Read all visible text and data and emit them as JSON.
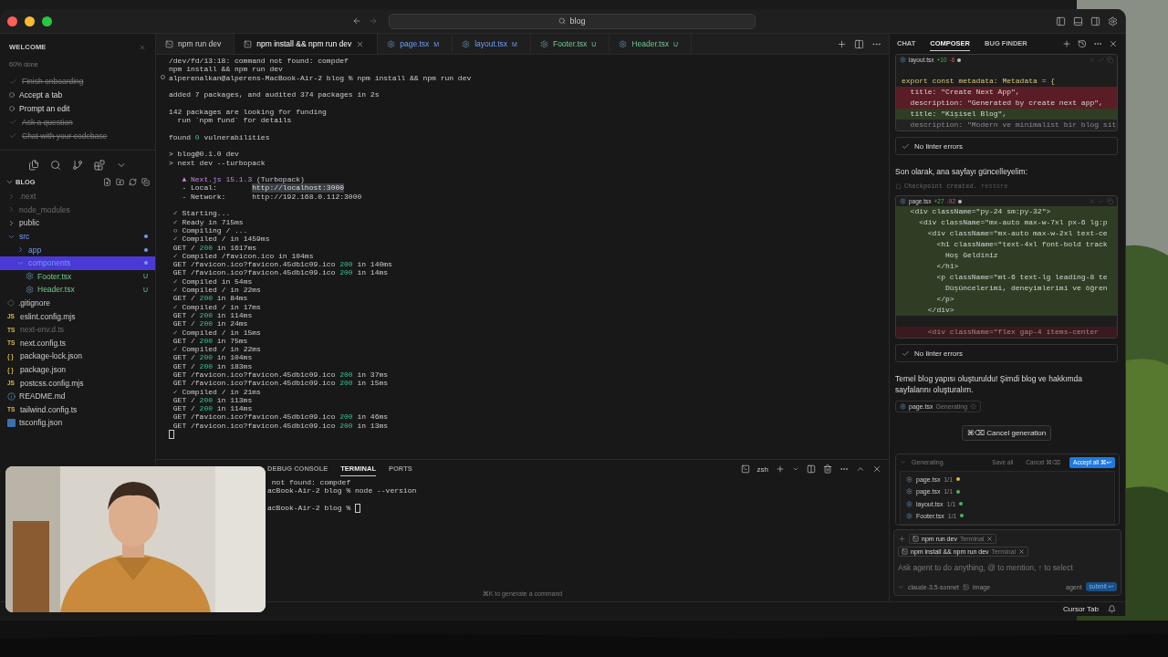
{
  "titlebar": {
    "search": "blog"
  },
  "welcome": {
    "title": "WELCOME",
    "progress": {
      "level": 0.6,
      "label": "60% done"
    },
    "tasks": [
      {
        "label": "Finish onboarding",
        "done": true
      },
      {
        "label": "Accept a tab",
        "done": false
      },
      {
        "label": "Prompt an edit",
        "done": false
      },
      {
        "label": "Ask a question",
        "done": true
      },
      {
        "label": "Chat with your codebase",
        "done": true
      }
    ]
  },
  "explorer": {
    "root": "BLOG",
    "items": [
      {
        "name": ".next",
        "kind": "folder",
        "expanded": false,
        "selected": false,
        "dimmed": true,
        "modified": false
      },
      {
        "name": "node_modules",
        "kind": "folder",
        "expanded": false,
        "selected": false,
        "dimmed": true,
        "modified": false
      },
      {
        "name": "public",
        "kind": "folder",
        "expanded": false,
        "selected": false,
        "dimmed": false,
        "modified": false
      },
      {
        "name": "src",
        "kind": "folder",
        "expanded": true,
        "selected": false,
        "dimmed": false,
        "modified": true,
        "children": [
          {
            "name": "app",
            "kind": "folder",
            "expanded": false,
            "selected": false,
            "dimmed": false,
            "modified": true
          },
          {
            "name": "components",
            "kind": "folder",
            "expanded": true,
            "selected": true,
            "dimmed": false,
            "modified": true,
            "children": [
              {
                "name": "Footer.tsx",
                "kind": "tsx",
                "selected": false,
                "dimmed": false,
                "modified": false,
                "status": "U"
              },
              {
                "name": "Header.tsx",
                "kind": "tsx",
                "selected": false,
                "dimmed": false,
                "modified": false,
                "status": "U"
              }
            ]
          }
        ]
      },
      {
        "name": ".gitignore",
        "kind": "gitignore",
        "selected": false,
        "dimmed": false,
        "modified": false
      },
      {
        "name": "eslint.config.mjs",
        "kind": "script",
        "badge": "JS",
        "selected": false,
        "dimmed": false,
        "modified": false
      },
      {
        "name": "next-env.d.ts",
        "kind": "script",
        "badge": "TS",
        "selected": false,
        "dimmed": true,
        "modified": false
      },
      {
        "name": "next.config.ts",
        "kind": "script",
        "badge": "TS",
        "selected": false,
        "dimmed": false,
        "modified": false
      },
      {
        "name": "package-lock.json",
        "kind": "script",
        "badge": "{ }",
        "selected": false,
        "dimmed": false,
        "modified": false
      },
      {
        "name": "package.json",
        "kind": "script",
        "badge": "{ }",
        "selected": false,
        "dimmed": false,
        "modified": false
      },
      {
        "name": "postcss.config.mjs",
        "kind": "script",
        "badge": "JS",
        "selected": false,
        "dimmed": false,
        "modified": false
      },
      {
        "name": "README.md",
        "kind": "readme",
        "selected": false,
        "dimmed": false,
        "modified": false
      },
      {
        "name": "tailwind.config.ts",
        "kind": "script",
        "badge": "TS",
        "selected": false,
        "dimmed": false,
        "modified": false
      },
      {
        "name": "tsconfig.json",
        "kind": "tsconfig",
        "selected": false,
        "dimmed": false,
        "modified": false
      }
    ]
  },
  "editor_tabs": [
    {
      "label": "npm run dev",
      "kind": "terminal",
      "selected": false,
      "modified": false
    },
    {
      "label": "npm install && npm run dev",
      "kind": "terminal",
      "selected": true,
      "modified": false
    },
    {
      "label": "page.tsx",
      "kind": "tsx",
      "status": "M",
      "modified": true,
      "selected": false
    },
    {
      "label": "layout.tsx",
      "kind": "tsx",
      "status": "M",
      "modified": true,
      "selected": false
    },
    {
      "label": "Footer.tsx",
      "kind": "tsx",
      "status": "U",
      "modified": false,
      "selected": false
    },
    {
      "label": "Header.tsx",
      "kind": "tsx",
      "status": "U",
      "modified": false,
      "selected": false
    }
  ],
  "terminal": {
    "lines": [
      {
        "text": "/dev/fd/13:18: command not found: compdef"
      },
      {
        "text": "npm install && npm run dev"
      },
      {
        "kind": "prompt",
        "text": "alperenalkan@alperens-MacBook-Air-2 blog % npm install && npm run dev"
      },
      {
        "kind": "blank"
      },
      {
        "text": "added 7 packages, and audited 374 packages in 2s"
      },
      {
        "kind": "blank"
      },
      {
        "text": "142 packages are looking for funding"
      },
      {
        "text": "  run `npm fund` for details"
      },
      {
        "kind": "blank"
      },
      {
        "segments": [
          {
            "kind": "plain",
            "text": "found "
          },
          {
            "kind": "ok",
            "text": "0"
          },
          {
            "kind": "plain",
            "text": " vulnerabilities"
          }
        ]
      },
      {
        "kind": "blank"
      },
      {
        "text": "> blog@0.1.0 dev"
      },
      {
        "text": "> next dev --turbopack"
      },
      {
        "kind": "blank"
      },
      {
        "segments": [
          {
            "kind": "brand",
            "text": "   ▲ Next.js 15.1.3"
          },
          {
            "kind": "plain",
            "text": " (Turbopack)"
          }
        ]
      },
      {
        "segments": [
          {
            "kind": "plain",
            "text": "   - Local:        "
          },
          {
            "kind": "selected",
            "text": "http://localhost:3000"
          }
        ]
      },
      {
        "text": "   - Network:      http://192.168.0.112:3000"
      },
      {
        "kind": "blank"
      },
      {
        "segments": [
          {
            "kind": "mark",
            "text": " ✓"
          },
          {
            "kind": "plain",
            "text": " Starting..."
          }
        ]
      },
      {
        "segments": [
          {
            "kind": "mark",
            "text": " ✓"
          },
          {
            "kind": "plain",
            "text": " Ready in 715ms"
          }
        ]
      },
      {
        "text": " ○ Compiling / ..."
      },
      {
        "segments": [
          {
            "kind": "mark",
            "text": " ✓"
          },
          {
            "kind": "plain",
            "text": " Compiled / in 1459ms"
          }
        ]
      },
      {
        "segments": [
          {
            "kind": "plain",
            "text": " GET / "
          },
          {
            "kind": "ok",
            "text": "200"
          },
          {
            "kind": "plain",
            "text": " in 1617ms"
          }
        ]
      },
      {
        "segments": [
          {
            "kind": "mark",
            "text": " ✓"
          },
          {
            "kind": "plain",
            "text": " Compiled /favicon.ico in 104ms"
          }
        ]
      },
      {
        "segments": [
          {
            "kind": "plain",
            "text": " GET /favicon.ico?favicon.45db1c09.ico "
          },
          {
            "kind": "ok",
            "text": "200"
          },
          {
            "kind": "plain",
            "text": " in 140ms"
          }
        ]
      },
      {
        "segments": [
          {
            "kind": "plain",
            "text": " GET /favicon.ico?favicon.45db1c09.ico "
          },
          {
            "kind": "ok",
            "text": "200"
          },
          {
            "kind": "plain",
            "text": " in 14ms"
          }
        ]
      },
      {
        "segments": [
          {
            "kind": "mark",
            "text": " ✓"
          },
          {
            "kind": "plain",
            "text": " Compiled in 54ms"
          }
        ]
      },
      {
        "segments": [
          {
            "kind": "mark",
            "text": " ✓"
          },
          {
            "kind": "plain",
            "text": " Compiled / in 22ms"
          }
        ]
      },
      {
        "segments": [
          {
            "kind": "plain",
            "text": " GET / "
          },
          {
            "kind": "ok",
            "text": "200"
          },
          {
            "kind": "plain",
            "text": " in 84ms"
          }
        ]
      },
      {
        "segments": [
          {
            "kind": "mark",
            "text": " ✓"
          },
          {
            "kind": "plain",
            "text": " Compiled / in 17ms"
          }
        ]
      },
      {
        "segments": [
          {
            "kind": "plain",
            "text": " GET / "
          },
          {
            "kind": "ok",
            "text": "200"
          },
          {
            "kind": "plain",
            "text": " in 114ms"
          }
        ]
      },
      {
        "segments": [
          {
            "kind": "plain",
            "text": " GET / "
          },
          {
            "kind": "ok",
            "text": "200"
          },
          {
            "kind": "plain",
            "text": " in 24ms"
          }
        ]
      },
      {
        "segments": [
          {
            "kind": "mark",
            "text": " ✓"
          },
          {
            "kind": "plain",
            "text": " Compiled / in 15ms"
          }
        ]
      },
      {
        "segments": [
          {
            "kind": "plain",
            "text": " GET / "
          },
          {
            "kind": "ok",
            "text": "200"
          },
          {
            "kind": "plain",
            "text": " in 75ms"
          }
        ]
      },
      {
        "segments": [
          {
            "kind": "mark",
            "text": " ✓"
          },
          {
            "kind": "plain",
            "text": " Compiled / in 22ms"
          }
        ]
      },
      {
        "segments": [
          {
            "kind": "plain",
            "text": " GET / "
          },
          {
            "kind": "ok",
            "text": "200"
          },
          {
            "kind": "plain",
            "text": " in 104ms"
          }
        ]
      },
      {
        "segments": [
          {
            "kind": "plain",
            "text": " GET / "
          },
          {
            "kind": "ok",
            "text": "200"
          },
          {
            "kind": "plain",
            "text": " in 183ms"
          }
        ]
      },
      {
        "segments": [
          {
            "kind": "plain",
            "text": " GET /favicon.ico?favicon.45db1c09.ico "
          },
          {
            "kind": "ok",
            "text": "200"
          },
          {
            "kind": "plain",
            "text": " in 37ms"
          }
        ]
      },
      {
        "segments": [
          {
            "kind": "plain",
            "text": " GET /favicon.ico?favicon.45db1c09.ico "
          },
          {
            "kind": "ok",
            "text": "200"
          },
          {
            "kind": "plain",
            "text": " in 15ms"
          }
        ]
      },
      {
        "segments": [
          {
            "kind": "mark",
            "text": " ✓"
          },
          {
            "kind": "plain",
            "text": " Compiled / in 21ms"
          }
        ]
      },
      {
        "segments": [
          {
            "kind": "plain",
            "text": " GET / "
          },
          {
            "kind": "ok",
            "text": "200"
          },
          {
            "kind": "plain",
            "text": " in 113ms"
          }
        ]
      },
      {
        "segments": [
          {
            "kind": "plain",
            "text": " GET / "
          },
          {
            "kind": "ok",
            "text": "200"
          },
          {
            "kind": "plain",
            "text": " in 114ms"
          }
        ]
      },
      {
        "segments": [
          {
            "kind": "plain",
            "text": " GET /favicon.ico?favicon.45db1c09.ico "
          },
          {
            "kind": "ok",
            "text": "200"
          },
          {
            "kind": "plain",
            "text": " in 46ms"
          }
        ]
      },
      {
        "segments": [
          {
            "kind": "plain",
            "text": " GET /favicon.ico?favicon.45db1c09.ico "
          },
          {
            "kind": "ok",
            "text": "200"
          },
          {
            "kind": "plain",
            "text": " in 13ms"
          }
        ]
      },
      {
        "kind": "cursor"
      }
    ]
  },
  "panel": {
    "tabs": [
      {
        "label": "DEBUG CONSOLE",
        "selected": false
      },
      {
        "label": "TERMINAL",
        "selected": true
      },
      {
        "label": "PORTS",
        "selected": false
      }
    ],
    "shell": "zsh",
    "lines": [
      {
        "text": " not found: compdef"
      },
      {
        "text": "acBook-Air-2 blog % node --version"
      },
      {
        "kind": "blank"
      },
      {
        "kind": "cursor",
        "text": "acBook-Air-2 blog % "
      }
    ],
    "hint": "⌘K to generate a command"
  },
  "composer": {
    "tabs": [
      {
        "label": "CHAT",
        "selected": false
      },
      {
        "label": "COMPOSER",
        "selected": true
      },
      {
        "label": "BUG FINDER",
        "selected": false
      }
    ],
    "feed": [
      {
        "kind": "diff",
        "file": "layout.tsx",
        "added": "+10",
        "removed": "-6",
        "lines": [
          {
            "kind": "blank"
          },
          {
            "kind": "context",
            "text": "export const metadata: Metadata = {"
          },
          {
            "kind": "removed",
            "text": "  title: \"Create Next App\","
          },
          {
            "kind": "removed",
            "text": "  description: \"Generated by create next app\","
          },
          {
            "kind": "added",
            "text": "  title: \"Kişisel Blog\","
          },
          {
            "kind": "faded",
            "text": "  description: \"Modern ve minimalist bir blog sit"
          }
        ]
      },
      {
        "kind": "lint",
        "text": "No linter errors"
      },
      {
        "kind": "message",
        "text": "Son olarak, ana sayfayı güncelleyelim:"
      },
      {
        "kind": "checkpoint",
        "text": "Checkpoint created.",
        "link": "restore"
      },
      {
        "kind": "diff",
        "file": "page.tsx",
        "added": "+27",
        "removed": "-92",
        "lines": [
          {
            "kind": "added",
            "text": "  <div className=\"py-24 sm:py-32\">"
          },
          {
            "kind": "added",
            "text": "    <div className=\"mx-auto max-w-7xl px-6 lg:p"
          },
          {
            "kind": "added",
            "text": "      <div className=\"mx-auto max-w-2xl text-ce"
          },
          {
            "kind": "added",
            "text": "        <h1 className=\"text-4xl font-bold track"
          },
          {
            "kind": "added",
            "text": "          Hoş Geldiniz"
          },
          {
            "kind": "added",
            "text": "        </h1>"
          },
          {
            "kind": "added",
            "text": "        <p className=\"mt-6 text-lg leading-8 te"
          },
          {
            "kind": "added",
            "text": "          Düşüncelerimi, deneyimlerimi ve öğren"
          },
          {
            "kind": "added",
            "text": "        </p>"
          },
          {
            "kind": "added",
            "text": "      </div>"
          },
          {
            "kind": "blank"
          },
          {
            "kind": "faded-removed",
            "text": "      <div className=\"flex gap-4 items-center"
          }
        ]
      },
      {
        "kind": "lint",
        "text": "No linter errors"
      },
      {
        "kind": "message",
        "text": "Temel blog yapısı oluşturuldu! Şimdi blog ve hakkımda sayfalarını oluşturalım."
      },
      {
        "kind": "chip",
        "file": "page.tsx",
        "status": "Generating"
      },
      {
        "kind": "cancel",
        "text": "⌘⌫ Cancel generation"
      }
    ],
    "review": {
      "title": "Generating.",
      "actions": [
        {
          "label": "Save all",
          "kind": "plain"
        },
        {
          "label": "Cancel ⌘⌫",
          "kind": "plain"
        },
        {
          "label": "Accept all ⌘↩",
          "kind": "primary"
        }
      ],
      "files": [
        {
          "name": "page.tsx",
          "count": "1/1",
          "color": "#d7ba4a"
        },
        {
          "name": "page.tsx",
          "count": "1/1",
          "color": "#4fb35a"
        },
        {
          "name": "layout.tsx",
          "count": "1/1",
          "color": "#4fb35a"
        },
        {
          "name": "Footer.tsx",
          "count": "1/1",
          "color": "#4fb35a"
        }
      ]
    },
    "context": [
      {
        "label": "npm run dev",
        "tag": "Terminal"
      },
      {
        "label": "npm install && npm run dev",
        "tag": "Terminal"
      }
    ],
    "input": {
      "placeholder": "Ask agent to do anything, @ to mention, ↑ to select"
    },
    "model": "claude-3.5-sonnet",
    "image": "image",
    "mode": "agent",
    "submit": "submit ↩"
  },
  "status": {
    "right": "Cursor Tab"
  }
}
